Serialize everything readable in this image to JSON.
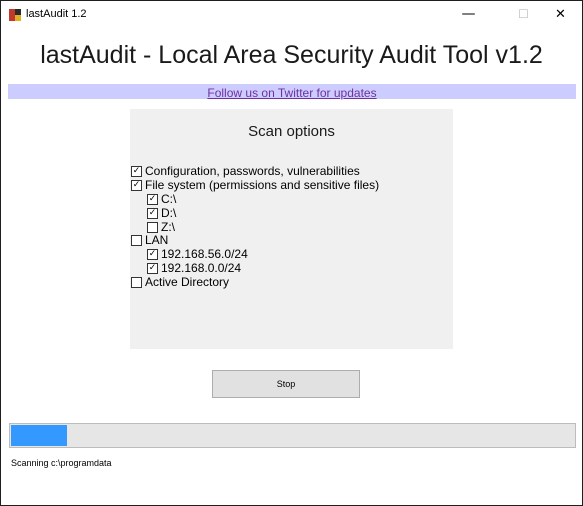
{
  "window": {
    "title": "lastAudit 1.2",
    "minimize_glyph": "—",
    "maximize_glyph": "☐",
    "close_glyph": "✕"
  },
  "header": {
    "title": "lastAudit - Local Area Security Audit Tool v1.2",
    "twitter_link": "Follow us on Twitter for updates"
  },
  "scan_options": {
    "heading": "Scan options",
    "items": [
      {
        "label": "Configuration, passwords, vulnerabilities",
        "checked": true
      },
      {
        "label": "File system (permissions and sensitive files)",
        "checked": true
      },
      {
        "label": "C:\\",
        "checked": true
      },
      {
        "label": "D:\\",
        "checked": true
      },
      {
        "label": "Z:\\",
        "checked": false
      },
      {
        "label": "LAN",
        "checked": false
      },
      {
        "label": "192.168.56.0/24",
        "checked": true
      },
      {
        "label": "192.168.0.0/24",
        "checked": true
      },
      {
        "label": "Active Directory",
        "checked": false
      }
    ]
  },
  "actions": {
    "stop_label": "Stop"
  },
  "progress": {
    "fraction": 0.1
  },
  "status": {
    "text": "Scanning c:\\programdata"
  },
  "colors": {
    "twitter_bar": "#ccccff",
    "link": "#7030a0",
    "progress_fill": "#3399ff"
  }
}
